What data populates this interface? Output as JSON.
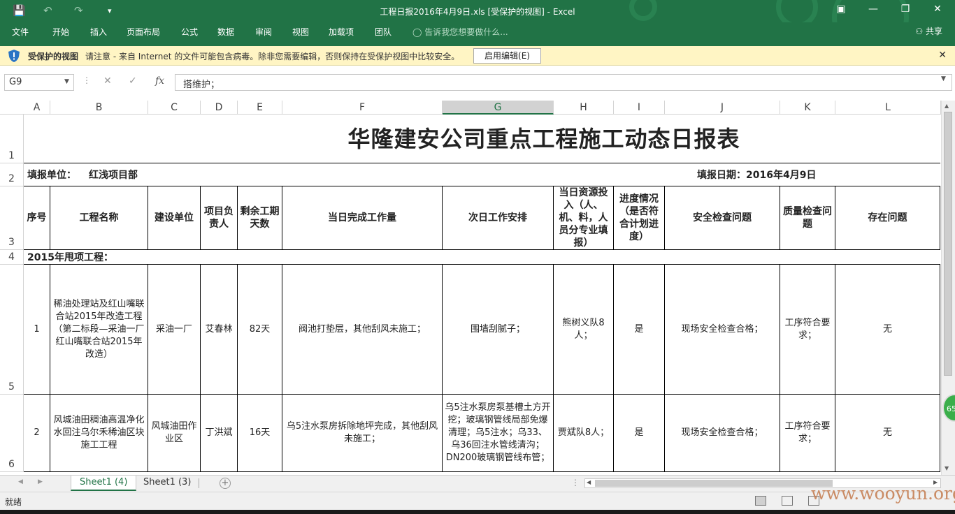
{
  "app": {
    "window_title": "工程日报2016年4月9日.xls  [受保护的视图] - Excel",
    "quick_access": [
      "save-icon",
      "undo-icon",
      "redo-icon",
      "customize-icon"
    ],
    "window_controls": [
      "ribbon-display-icon",
      "minimize-icon",
      "restore-icon",
      "close-icon"
    ]
  },
  "ribbon": {
    "tabs": [
      "文件",
      "开始",
      "插入",
      "页面布局",
      "公式",
      "数据",
      "审阅",
      "视图",
      "加载项",
      "团队"
    ],
    "tell_me": "告诉我您想要做什么...",
    "share": "共享"
  },
  "protected_view": {
    "title": "受保护的视图",
    "message": "请注意 - 来自 Internet 的文件可能包含病毒。除非您需要编辑，否则保持在受保护视图中比较安全。",
    "enable_button": "启用编辑(E)"
  },
  "formula_bar": {
    "name_box": "G9",
    "fx": "fx",
    "content": "搭维护；"
  },
  "columns": [
    "A",
    "B",
    "C",
    "D",
    "E",
    "F",
    "G",
    "H",
    "I",
    "J",
    "K",
    "L"
  ],
  "selected_column": "G",
  "rows": [
    "1",
    "2",
    "3",
    "4",
    "5",
    "6"
  ],
  "sheet": {
    "title": "华隆建安公司重点工程施工动态日报表",
    "unit_label": "填报单位：",
    "unit_value": "红浅项目部",
    "date_label": "填报日期：2016年4月9日",
    "headers": [
      "序号",
      "工程名称",
      "建设单位",
      "项目负责人",
      "剩余工期天数",
      "当日完成工作量",
      "次日工作安排",
      "当日资源投入（人、机、料，人员分专业填报）",
      "进度情况（是否符合计划进度）",
      "安全检查问题",
      "质量检查问题",
      "存在问题"
    ],
    "section_label": "2015年甩项工程：",
    "records": [
      [
        "1",
        "稀油处理站及红山嘴联合站2015年改造工程（第二标段—采油一厂红山嘴联合站2015年改造）",
        "采油一厂",
        "艾春林",
        "82天",
        "阀池打垫层，其他刮风未施工；",
        "围墙刮腻子；",
        "熊树义队8人；",
        "是",
        "现场安全检查合格；",
        "工序符合要求；",
        "无"
      ],
      [
        "2",
        "风城油田稠油高温净化水回注乌尔禾稀油区块施工工程",
        "风城油田作业区",
        "丁洪斌",
        "16天",
        "乌5注水泵房拆除地坪完成，其他刮风未施工；",
        "乌5注水泵房泵基槽土方开挖；玻璃钢管线局部免爆清理；乌5注水；乌33、乌36回注水管线清沟；DN200玻璃钢管线布管；",
        "贾斌队8人；",
        "是",
        "现场安全检查合格；",
        "工序符合要求；",
        "无"
      ]
    ]
  },
  "sheet_tabs": [
    "Sheet1 (4)",
    "Sheet1 (3)"
  ],
  "active_sheet_tab": "Sheet1 (4)",
  "status": {
    "ready": "就绪",
    "view_buttons": [
      "normal-view-icon",
      "page-layout-view-icon",
      "page-break-view-icon"
    ]
  },
  "overlay": {
    "watermark": "www.wooyun.org",
    "badge": "65"
  }
}
